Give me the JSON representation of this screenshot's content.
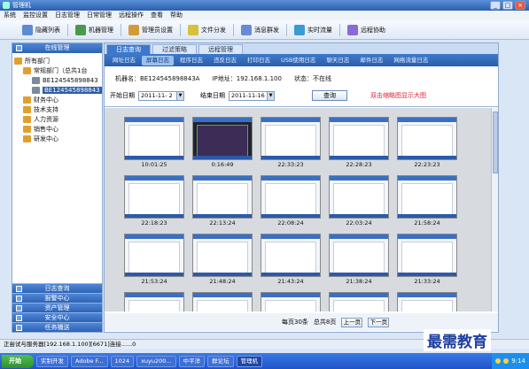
{
  "window": {
    "title": "管理机"
  },
  "menubar": {
    "items": [
      "系统",
      "监控设置",
      "日志管理",
      "日常管理",
      "远程操作",
      "查看",
      "帮助"
    ]
  },
  "toolbar": {
    "items": [
      {
        "label": "隐藏列表",
        "icon": "hide-list-icon",
        "color": "#5b8bd4"
      },
      {
        "label": "机器管理",
        "icon": "machine-icon",
        "color": "#4a9a4a"
      },
      {
        "label": "管理员设置",
        "icon": "admin-icon",
        "color": "#d49a3a"
      },
      {
        "label": "文件分发",
        "icon": "file-icon",
        "color": "#d4c23a"
      },
      {
        "label": "消息群发",
        "icon": "message-icon",
        "color": "#6a8ad8"
      },
      {
        "label": "实时流量",
        "icon": "traffic-icon",
        "color": "#3a9ad4"
      },
      {
        "label": "远程协助",
        "icon": "remote-icon",
        "color": "#8a6ad4"
      }
    ]
  },
  "sidebar": {
    "header": "在线管理",
    "tree": [
      {
        "label": "所有部门",
        "indent": 0,
        "color": "#e0a030"
      },
      {
        "label": "常规部门（总共1台",
        "indent": 1,
        "color": "#e0a030"
      },
      {
        "label": "BE124545898843",
        "indent": 2,
        "color": "#7a8a9a"
      },
      {
        "label": "BE124545898843",
        "indent": 2,
        "color": "#7a8a9a",
        "selected": true
      },
      {
        "label": "财务中心",
        "indent": 1,
        "color": "#e0a030"
      },
      {
        "label": "技术支持",
        "indent": 1,
        "color": "#e0a030"
      },
      {
        "label": "人力资源",
        "indent": 1,
        "color": "#e0a030"
      },
      {
        "label": "销售中心",
        "indent": 1,
        "color": "#e0a030"
      },
      {
        "label": "研发中心",
        "indent": 1,
        "color": "#e0a030"
      }
    ],
    "bottom": [
      "日志查询",
      "报警中心",
      "资产管理",
      "安全中心",
      "任务播送"
    ]
  },
  "main": {
    "toptabs": [
      {
        "label": "日志查询",
        "active": true
      },
      {
        "label": "过滤策略",
        "active": false
      },
      {
        "label": "远程管理",
        "active": false
      }
    ],
    "subtabs": [
      {
        "label": "网址日志",
        "active": false
      },
      {
        "label": "屏幕日志",
        "active": true
      },
      {
        "label": "程序日志",
        "active": false
      },
      {
        "label": "违反日志",
        "active": false
      },
      {
        "label": "打印日志",
        "active": false
      },
      {
        "label": "USB使用日志",
        "active": false
      },
      {
        "label": "聊天日志",
        "active": false
      },
      {
        "label": "邮件日志",
        "active": false
      },
      {
        "label": "网络流量日志",
        "active": false
      }
    ],
    "info": {
      "machine": "机器名：BE124545898843A",
      "ip": "IP地址：192.168.1.100",
      "status": "状态：不在线"
    },
    "filter": {
      "start_label": "开始日期",
      "start_value": "2011-11- 2",
      "end_label": "结束日期",
      "end_value": "2011-11-16",
      "query_label": "查询",
      "hint": "双击缩略图显示大图"
    },
    "thumbnails": [
      {
        "time": "10:01:25",
        "style": "light"
      },
      {
        "time": "0:16:49",
        "style": "dark"
      },
      {
        "time": "22:33:23",
        "style": "light"
      },
      {
        "time": "22:28:23",
        "style": "light"
      },
      {
        "time": "22:23:23",
        "style": "light"
      },
      {
        "time": "22:18:23",
        "style": "light"
      },
      {
        "time": "22:13:24",
        "style": "light"
      },
      {
        "time": "22:08:24",
        "style": "light"
      },
      {
        "time": "22:03:24",
        "style": "light"
      },
      {
        "time": "21:58:24",
        "style": "light"
      },
      {
        "time": "21:53:24",
        "style": "light"
      },
      {
        "time": "21:48:24",
        "style": "light"
      },
      {
        "time": "21:43:24",
        "style": "light"
      },
      {
        "time": "21:38:24",
        "style": "light"
      },
      {
        "time": "21:33:24",
        "style": "light"
      },
      {
        "time": "",
        "style": "light"
      },
      {
        "time": "",
        "style": "light"
      },
      {
        "time": "",
        "style": "light"
      },
      {
        "time": "",
        "style": "light"
      },
      {
        "time": "",
        "style": "light"
      }
    ],
    "pager": {
      "per_page": "每页30条",
      "total_pages": "总共8页",
      "prev": "上一页",
      "next": "下一页"
    }
  },
  "statusbar": {
    "text": "正尝试与服务器[192.168.1.100][6671]连接......0"
  },
  "taskbar": {
    "start": "开始",
    "tasks": [
      {
        "label": "实制开发",
        "active": false
      },
      {
        "label": "Adobe F...",
        "active": false
      },
      {
        "label": "1024",
        "active": false
      },
      {
        "label": "xuyu200...",
        "active": false
      },
      {
        "label": "中平洋",
        "active": false
      },
      {
        "label": "群论坛",
        "active": false
      },
      {
        "label": "管理机",
        "active": true
      }
    ],
    "clock": "9:14"
  },
  "watermark": "最需教育"
}
